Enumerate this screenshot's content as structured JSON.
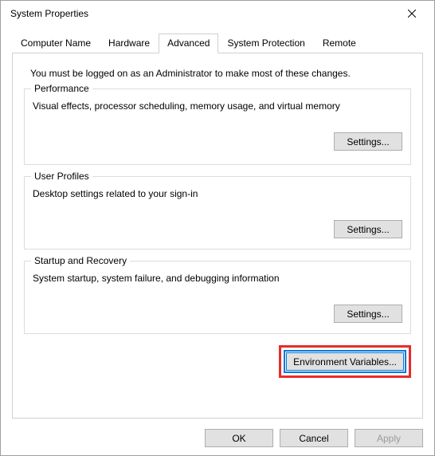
{
  "window": {
    "title": "System Properties"
  },
  "tabs": {
    "computerName": "Computer Name",
    "hardware": "Hardware",
    "advanced": "Advanced",
    "systemProtection": "System Protection",
    "remote": "Remote"
  },
  "admin_note": "You must be logged on as an Administrator to make most of these changes.",
  "performance": {
    "legend": "Performance",
    "desc": "Visual effects, processor scheduling, memory usage, and virtual memory",
    "button": "Settings..."
  },
  "userProfiles": {
    "legend": "User Profiles",
    "desc": "Desktop settings related to your sign-in",
    "button": "Settings..."
  },
  "startupRecovery": {
    "legend": "Startup and Recovery",
    "desc": "System startup, system failure, and debugging information",
    "button": "Settings..."
  },
  "envVariables": {
    "button": "Environment Variables..."
  },
  "dialog": {
    "ok": "OK",
    "cancel": "Cancel",
    "apply": "Apply"
  }
}
